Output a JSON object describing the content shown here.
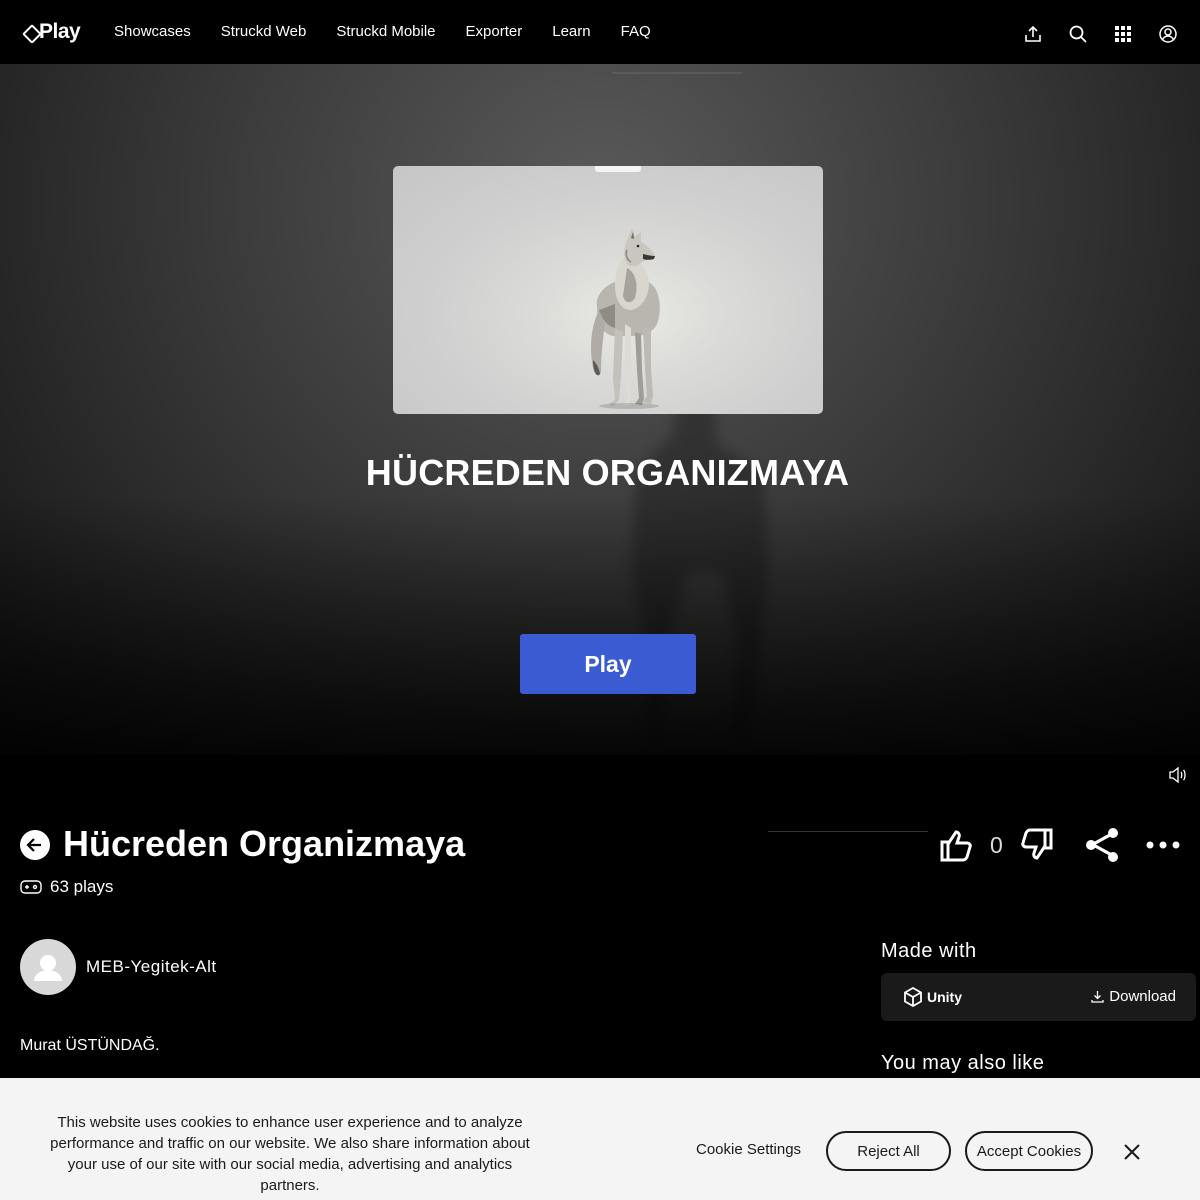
{
  "nav": {
    "logo_text": "Play",
    "links": [
      "Showcases",
      "Struckd Web",
      "Struckd Mobile",
      "Exporter",
      "Learn",
      "FAQ"
    ],
    "icons": [
      "upload-icon",
      "search-icon",
      "apps-grid-icon",
      "account-icon"
    ]
  },
  "hero": {
    "title": "HÜCREDEN ORGANIZMAYA",
    "play_label": "Play"
  },
  "game": {
    "title": "Hücreden Organizmaya",
    "plays": "63 plays",
    "likes": "0",
    "author": "MEB-Yegitek-Alt",
    "description": "Murat ÜSTÜNDAĞ."
  },
  "sidebar": {
    "made_with": "Made with",
    "engine": "Unity",
    "download": "Download",
    "also_like": "You may also like"
  },
  "cookie": {
    "text": "This website uses cookies to enhance user experience and to analyze performance and traffic on our website. We also share information about your use of our site with our social media, advertising and analytics partners.",
    "settings": "Cookie Settings",
    "reject": "Reject All",
    "accept": "Accept Cookies"
  },
  "colors": {
    "play_button": "#3a5bd1",
    "background": "#000000",
    "banner": "#f4f4f4"
  }
}
